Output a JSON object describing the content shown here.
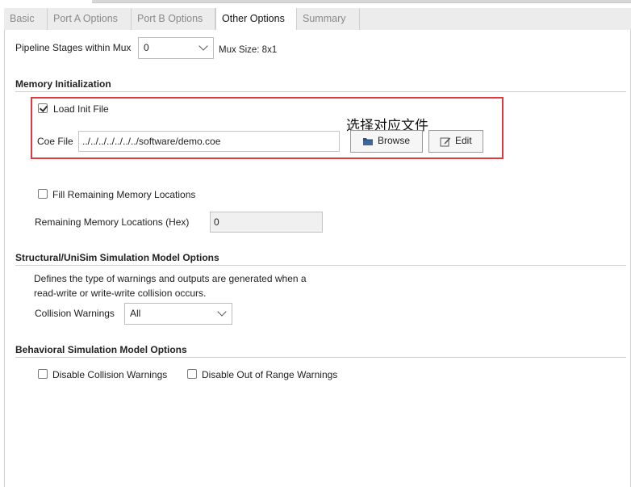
{
  "tabs": [
    {
      "label": "Basic",
      "active": false
    },
    {
      "label": "Port A Options",
      "active": false
    },
    {
      "label": "Port B Options",
      "active": false
    },
    {
      "label": "Other Options",
      "active": true
    },
    {
      "label": "Summary",
      "active": false
    }
  ],
  "pipeline": {
    "label": "Pipeline Stages within Mux",
    "value": "0",
    "mux_size": "Mux Size: 8x1"
  },
  "memory_init": {
    "title": "Memory Initialization",
    "load_init_label": "Load Init File",
    "load_init_checked": true,
    "coe_label": "Coe File",
    "coe_value": "../../../../../../../software/demo.coe",
    "browse_label": "Browse",
    "edit_label": "Edit",
    "annotation": "选择对应文件",
    "annotation_color": "#e2393f",
    "fill_remaining_label": "Fill Remaining Memory Locations",
    "fill_remaining_checked": false,
    "remaining_label": "Remaining Memory Locations (Hex)",
    "remaining_value": "0"
  },
  "structural": {
    "title": "Structural/UniSim Simulation Model Options",
    "description_line1": "Defines the type of warnings and outputs are generated when a",
    "description_line2": "read-write or write-write collision occurs.",
    "collision_label": "Collision Warnings",
    "collision_value": "All"
  },
  "behavioral": {
    "title": "Behavioral Simulation Model Options",
    "disable_collision_label": "Disable Collision Warnings",
    "disable_collision_checked": false,
    "disable_range_label": "Disable Out of Range Warnings",
    "disable_range_checked": false
  }
}
